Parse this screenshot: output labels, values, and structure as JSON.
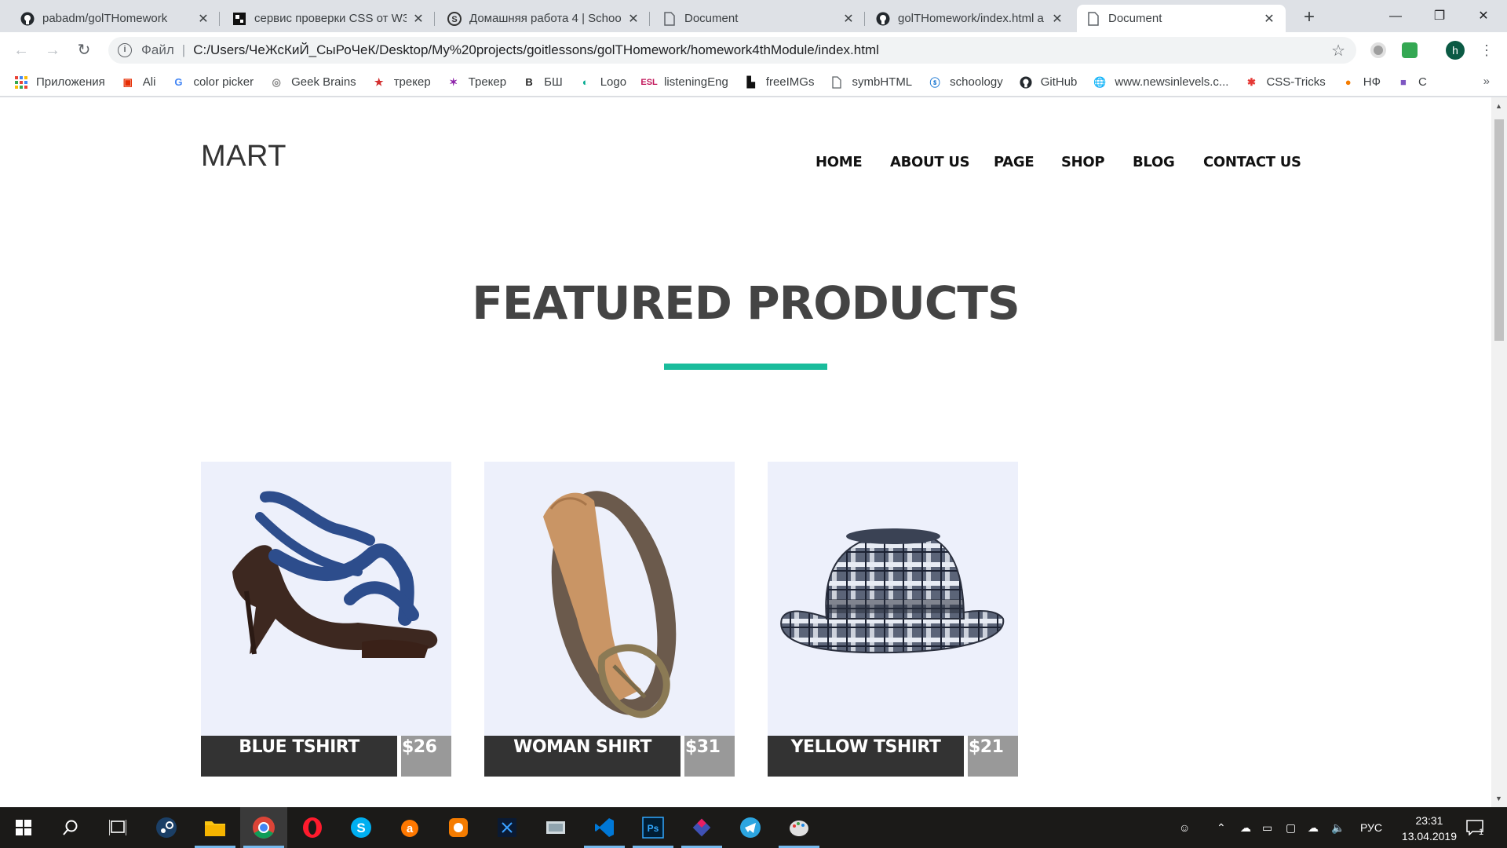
{
  "browser": {
    "tabs": [
      {
        "title": "pabadm/golTHomework",
        "icon": "github-icon"
      },
      {
        "title": "сервис проверки CSS от W3",
        "icon": "w3c-icon"
      },
      {
        "title": "Домашняя работа 4 | Schoo",
        "icon": "schoology-icon"
      },
      {
        "title": "Document",
        "icon": "document-icon"
      },
      {
        "title": "golTHomework/index.html a",
        "icon": "github-icon"
      },
      {
        "title": "Document",
        "icon": "document-icon"
      }
    ],
    "address": {
      "scheme_label": "Файл",
      "url": "C:/Users/ЧеЖсКиЙ_СыРоЧеК/Desktop/My%20projects/goitlessons/golTHomework/homework4thModule/index.html"
    },
    "profile_initial": "h",
    "bookmarks": [
      {
        "label": "Приложения",
        "icon": "apps-grid-icon"
      },
      {
        "label": "Ali",
        "icon": "aliexpress-icon"
      },
      {
        "label": "color picker",
        "icon": "google-icon"
      },
      {
        "label": "Geek Brains",
        "icon": "geekbrains-icon"
      },
      {
        "label": "трекер",
        "icon": "tracker-icon"
      },
      {
        "label": "Трекер",
        "icon": "tracker2-icon"
      },
      {
        "label": "БШ",
        "icon": "bsh-icon"
      },
      {
        "label": "Logo",
        "icon": "logo-icon"
      },
      {
        "label": "listeningEng",
        "icon": "esl-icon"
      },
      {
        "label": "freeIMGs",
        "icon": "unsplash-icon"
      },
      {
        "label": "symbHTML",
        "icon": "page-icon"
      },
      {
        "label": "schoology",
        "icon": "schoology-icon"
      },
      {
        "label": "GitHub",
        "icon": "github-icon"
      },
      {
        "label": "www.newsinlevels.c...",
        "icon": "globe-icon"
      },
      {
        "label": "CSS-Tricks",
        "icon": "css-tricks-icon"
      },
      {
        "label": "НФ",
        "icon": "orange-icon"
      },
      {
        "label": "С",
        "icon": "purple-square-icon"
      }
    ]
  },
  "site": {
    "logo": "MART",
    "nav": [
      "HOME",
      "ABOUT US",
      "PAGE",
      "SHOP",
      "BLOG",
      "CONTACT US"
    ],
    "section_title": "FEATURED PRODUCTS",
    "accent_color": "#1abc9c",
    "products": [
      {
        "name": "BLUE TSHIRT",
        "price": "$26",
        "image": "blue-sandal"
      },
      {
        "name": "WOMAN SHIRT",
        "price": "$31",
        "image": "leather-belt"
      },
      {
        "name": "YELLOW TSHIRT",
        "price": "$21",
        "image": "plaid-fedora"
      }
    ]
  },
  "taskbar": {
    "language": "РУС",
    "time": "23:31",
    "date": "13.04.2019",
    "notification_count": "1"
  }
}
